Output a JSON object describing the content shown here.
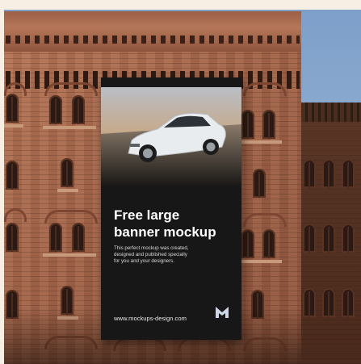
{
  "scene": {
    "description_colors": {
      "sky": "#8aa9d0",
      "brick": "#a8694d",
      "banner_bg": "#171717"
    }
  },
  "banner": {
    "headline": "Free large\nbanner mockup",
    "body": "This perfect mockup was created,\ndesigned and published specially\nfor you and your designers.",
    "url": "www.mockups-design.com",
    "logo_icon": "mockups-design-logo-icon"
  }
}
